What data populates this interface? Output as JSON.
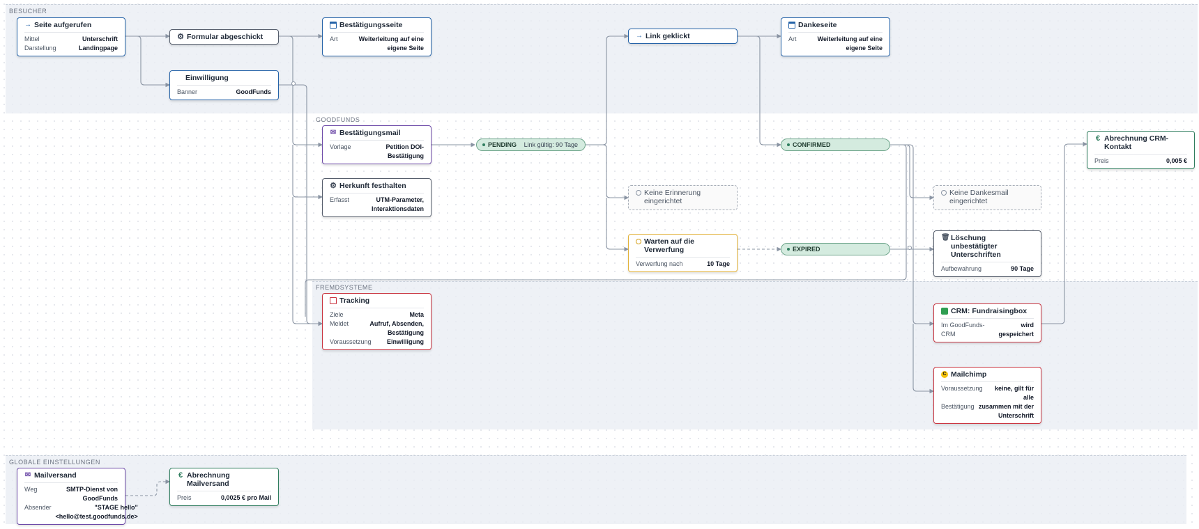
{
  "lanes": {
    "besucher": "BESUCHER",
    "goodfunds": "GOODFUNDS",
    "fremdsysteme": "FREMDSYSTEME",
    "global": "GLOBALE EINSTELLUNGEN"
  },
  "nodes": {
    "seite": {
      "title": "Seite aufgerufen",
      "rows": [
        {
          "k": "Mittel",
          "v": "Unterschrift"
        },
        {
          "k": "Darstellung",
          "v": "Landingpage"
        }
      ]
    },
    "formular": {
      "title": "Formular abgeschickt"
    },
    "einwilligung": {
      "title": "Einwilligung",
      "rows": [
        {
          "k": "Banner",
          "v": "GoodFunds"
        }
      ]
    },
    "bestaetigungsseite": {
      "title": "Bestätigungsseite",
      "rows": [
        {
          "k": "Art",
          "v": "Weiterleitung auf eine eigene Seite"
        }
      ]
    },
    "link": {
      "title": "Link geklickt"
    },
    "dankeseite": {
      "title": "Dankeseite",
      "rows": [
        {
          "k": "Art",
          "v": "Weiterleitung auf eine eigene Seite"
        }
      ]
    },
    "mail": {
      "title": "Bestätigungsmail",
      "rows": [
        {
          "k": "Vorlage",
          "v": "Petition DOI-Bestätigung"
        }
      ]
    },
    "herkunft": {
      "title": "Herkunft festhalten",
      "rows": [
        {
          "k": "Erfasst",
          "v": "UTM-Parameter, Interaktionsdaten"
        }
      ]
    },
    "keine_erinnerung": {
      "title": "Keine Erinnerung eingerichtet"
    },
    "warten": {
      "title": "Warten auf die Verwerfung",
      "rows": [
        {
          "k": "Verwerfung nach",
          "v": "10 Tage"
        }
      ]
    },
    "keine_dankesmail": {
      "title": "Keine Dankesmail eingerichtet"
    },
    "loeschung": {
      "title": "Löschung unbestätigter Unterschriften",
      "rows": [
        {
          "k": "Aufbewahrung",
          "v": "90 Tage"
        }
      ]
    },
    "abrechnung_crm": {
      "title": "Abrechnung CRM-Kontakt",
      "rows": [
        {
          "k": "Preis",
          "v": "0,005 €"
        }
      ]
    },
    "tracking": {
      "title": "Tracking",
      "rows": [
        {
          "k": "Ziele",
          "v": "Meta"
        },
        {
          "k": "Meldet",
          "v": "Aufruf, Absenden, Bestätigung"
        },
        {
          "k": "Voraussetzung",
          "v": "Einwilligung"
        }
      ]
    },
    "crm": {
      "title": "CRM: Fundraisingbox",
      "rows": [
        {
          "k": "Im GoodFunds-CRM",
          "v": "wird gespeichert"
        }
      ]
    },
    "mailchimp": {
      "title": "Mailchimp",
      "rows": [
        {
          "k": "Voraussetzung",
          "v": "keine, gilt für alle"
        },
        {
          "k": "Bestätigung",
          "v": "zusammen mit der Unterschrift"
        }
      ]
    },
    "mailversand": {
      "title": "Mailversand",
      "rows": [
        {
          "k": "Weg",
          "v": "SMTP-Dienst von GoodFunds"
        },
        {
          "k": "Absender",
          "v": "\"STAGE hello\" <hello@test.goodfunds.de>"
        }
      ]
    },
    "abrechnung_mail": {
      "title": "Abrechnung Mailversand",
      "rows": [
        {
          "k": "Preis",
          "v": "0,0025 € pro Mail"
        }
      ]
    }
  },
  "pills": {
    "pending": {
      "label": "PENDING",
      "extra": "Link gültig: 90 Tage"
    },
    "confirmed": {
      "label": "CONFIRMED"
    },
    "expired": {
      "label": "EXPIRED"
    }
  },
  "icons": {
    "seite": "enter-icon",
    "formular": "gear-icon",
    "bestaetigungsseite": "page-icon",
    "link": "enter-icon",
    "dankeseite": "page-icon",
    "mail": "mail-icon",
    "herkunft": "gear-icon",
    "keine_erinnerung": "clock-icon",
    "warten": "clock-icon",
    "keine_dankesmail": "clock-icon",
    "loeschung": "trash-icon",
    "abrechnung_crm": "euro-icon",
    "tracking": "edit-icon",
    "crm": "cube-icon",
    "mailchimp": "mailchimp-icon",
    "mailversand": "mail-icon",
    "abrechnung_mail": "euro-icon"
  },
  "colors": {
    "blue": "#2563a8",
    "gray": "#555d6b",
    "purple": "#6d4aa8",
    "red": "#c9333f",
    "green": "#2f7d5e",
    "yellow": "#e2b23a",
    "edge": "#8a94a3"
  }
}
